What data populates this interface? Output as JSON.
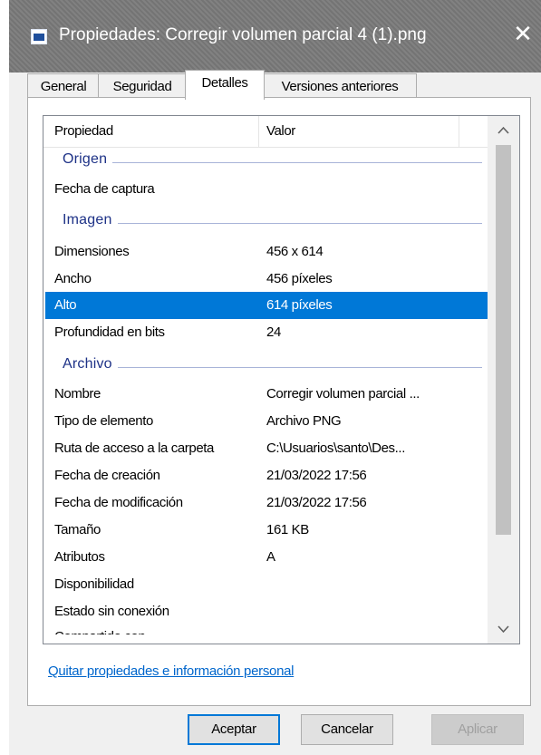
{
  "window": {
    "title": "Propiedades: Corregir volumen parcial 4 (1).png",
    "close_glyph": "✕"
  },
  "tabs": [
    {
      "label": "General",
      "active": false
    },
    {
      "label": "Seguridad",
      "active": false
    },
    {
      "label": "Detalles",
      "active": true
    },
    {
      "label": "Versiones anteriores",
      "active": false
    }
  ],
  "details": {
    "columns": {
      "property": "Propiedad",
      "value": "Valor"
    },
    "groups": [
      {
        "label": "Origen"
      },
      {
        "label": "Imagen"
      },
      {
        "label": "Archivo"
      }
    ],
    "rows": [
      {
        "property": "Fecha de captura",
        "value": ""
      },
      {
        "property": "Dimensiones",
        "value": "456 x 614"
      },
      {
        "property": "Ancho",
        "value": "456 píxeles"
      },
      {
        "property": "Alto",
        "value": "614 píxeles",
        "selected": true
      },
      {
        "property": "Profundidad en bits",
        "value": "24"
      },
      {
        "property": "Nombre",
        "value": "Corregir volumen parcial ..."
      },
      {
        "property": "Tipo de elemento",
        "value": "Archivo PNG"
      },
      {
        "property": "Ruta de acceso a la carpeta",
        "value": "C:\\Usuarios\\santo\\Des..."
      },
      {
        "property": "Fecha de creación",
        "value": "21/03/2022 17:56"
      },
      {
        "property": "Fecha de modificación",
        "value": "21/03/2022 17:56"
      },
      {
        "property": "Tamaño",
        "value": "161 KB"
      },
      {
        "property": "Atributos",
        "value": "A"
      },
      {
        "property": "Disponibilidad",
        "value": ""
      },
      {
        "property": "Estado sin conexión",
        "value": ""
      },
      {
        "property": "Compartido con",
        "value": ""
      }
    ]
  },
  "scroll": {
    "up_glyph": "∧",
    "down_glyph": "∨"
  },
  "links": {
    "remove_properties": "Quitar propiedades e información personal"
  },
  "buttons": {
    "ok": "Aceptar",
    "cancel": "Cancelar",
    "apply": "Aplicar"
  },
  "colors": {
    "selection": "#0078d7",
    "link": "#0066cc",
    "group_header": "#1e3287"
  }
}
